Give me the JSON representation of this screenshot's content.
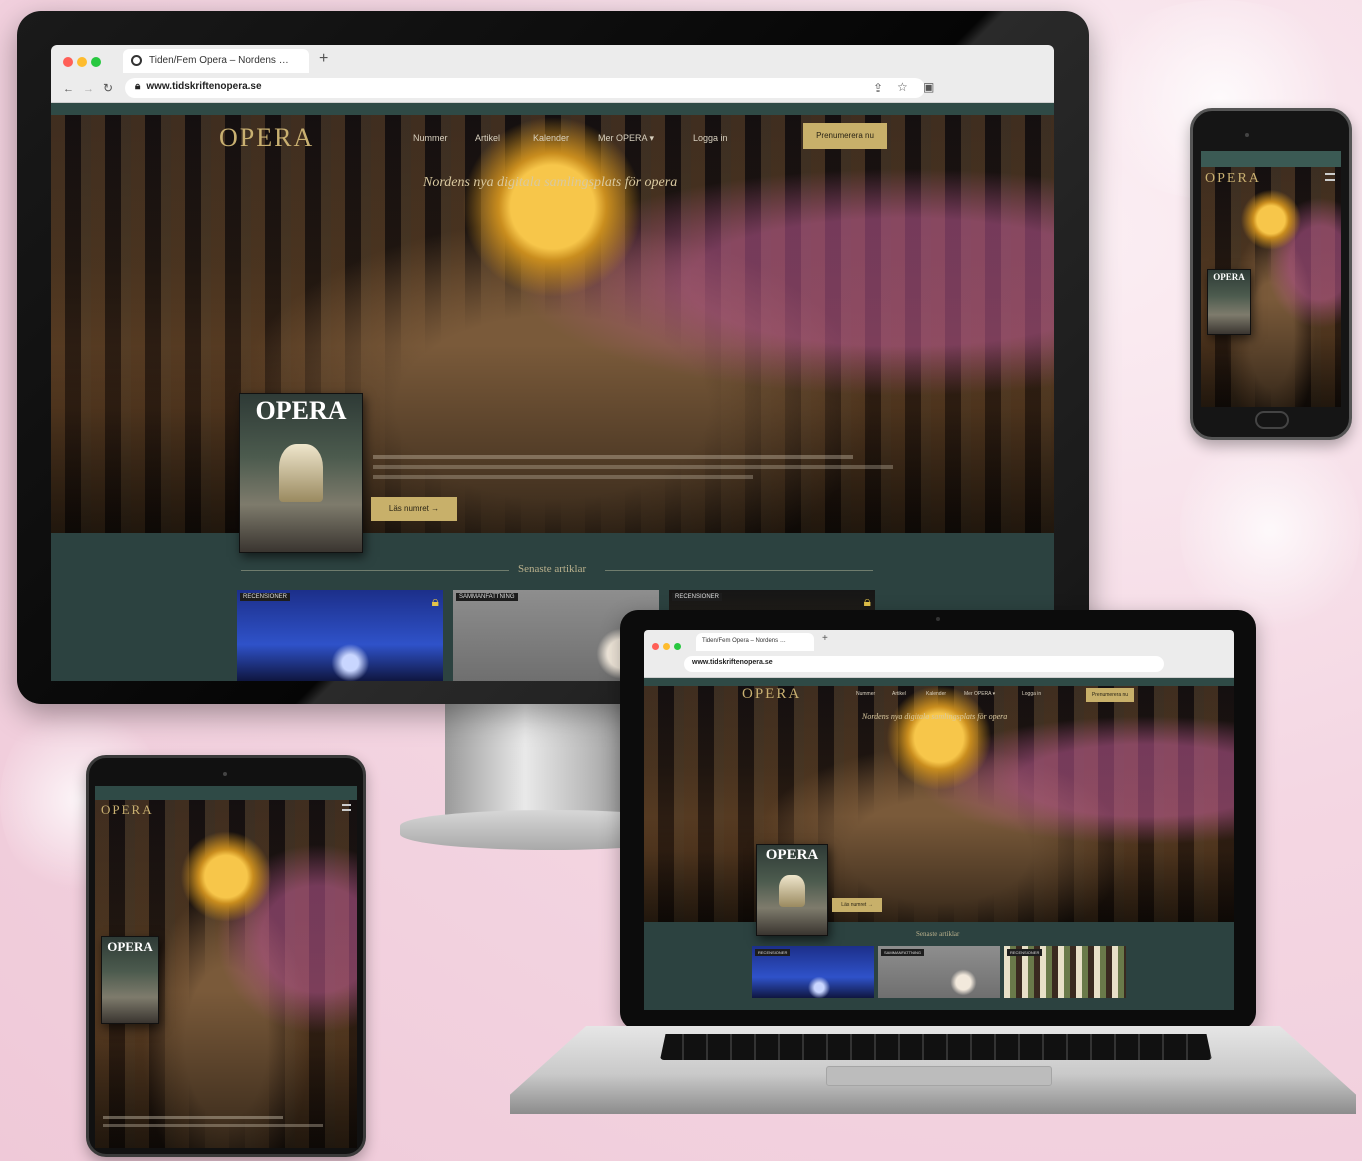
{
  "browser": {
    "tab_title": "Tiden/Fem Opera – Nordens …",
    "new_tab": "+",
    "url": "www.tidskriftenopera.se",
    "mini_tab_title": "Tiden/Fem Opera – Nordens …",
    "mini_url": "www.tidskriftenopera.se"
  },
  "site": {
    "logo": "OPERA",
    "nav": [
      "Nummer",
      "Artikel",
      "Kalender",
      "Mer OPERA ▾",
      "Logga in"
    ],
    "cta": "Prenumerera nu",
    "tagline": "Nordens nya digitala samlingsplats för opera",
    "cover_title": "OPERA",
    "read_more": "Läs numret →",
    "section_title": "Senaste artiklar",
    "cards": [
      {
        "badge": "RECENSIONER",
        "locked": true
      },
      {
        "badge": "SAMMANFATTNING",
        "locked": false
      },
      {
        "badge": "RECENSIONER",
        "locked": true
      }
    ]
  },
  "icons": {
    "lock": "lock-icon",
    "back": "back-icon",
    "forward": "forward-icon",
    "reload": "reload-icon",
    "share": "share-icon",
    "star": "star-icon",
    "menu": "hamburger-icon"
  },
  "colors": {
    "accent_gold": "#c8b06a",
    "site_green": "#2c4240",
    "background_pink": "#f4d7e3"
  }
}
